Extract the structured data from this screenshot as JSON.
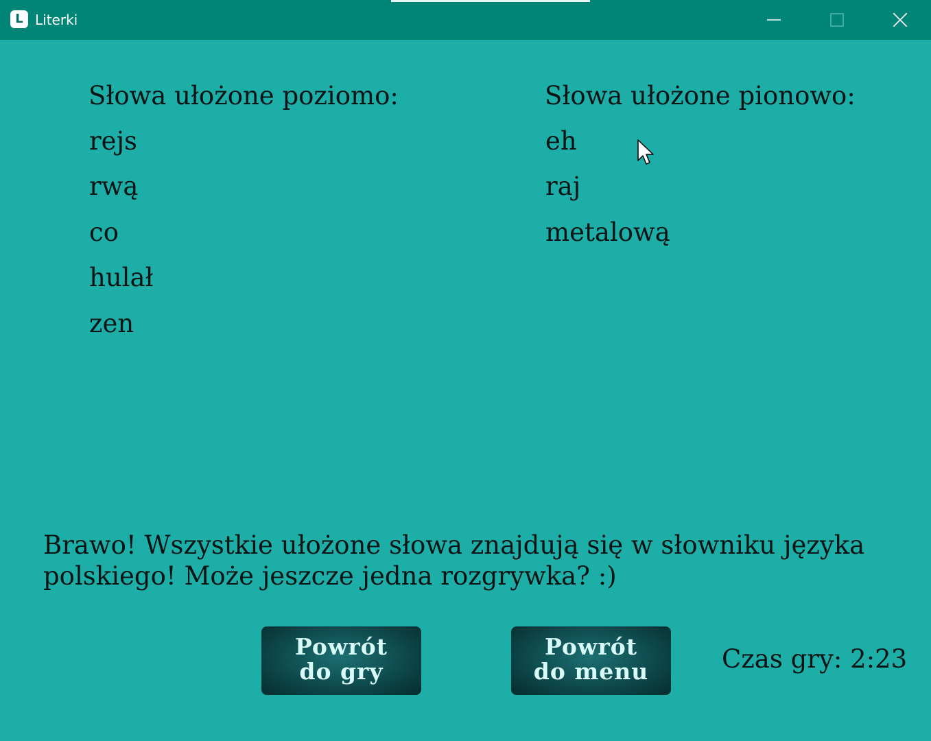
{
  "window": {
    "title": "Literki",
    "icon_letter": "L",
    "icon": "app-logo-icon",
    "controls": [
      "minimize-icon",
      "maximize-icon",
      "close-icon"
    ]
  },
  "colors": {
    "background": "#1daea8",
    "titlebar": "#008577",
    "button": "#0e4a4d",
    "button_text": "#d9fbf8",
    "text": "#0b1414"
  },
  "horizontal": {
    "heading": "Słowa ułożone poziomo:",
    "words": [
      "rejs",
      "rwą",
      "co",
      "hulał",
      "zen"
    ]
  },
  "vertical": {
    "heading": "Słowa ułożone pionowo:",
    "words": [
      "eh",
      "raj",
      "metalową"
    ]
  },
  "message": "Brawo! Wszystkie ułożone słowa znajdują się w słowniku języka polskiego! Może jeszcze jedna rozgrywka? :)",
  "buttons": {
    "back_to_game": [
      "Powrót",
      "do gry"
    ],
    "back_to_menu": [
      "Powrót",
      "do menu"
    ]
  },
  "game_time": "Czas gry: 2:23"
}
